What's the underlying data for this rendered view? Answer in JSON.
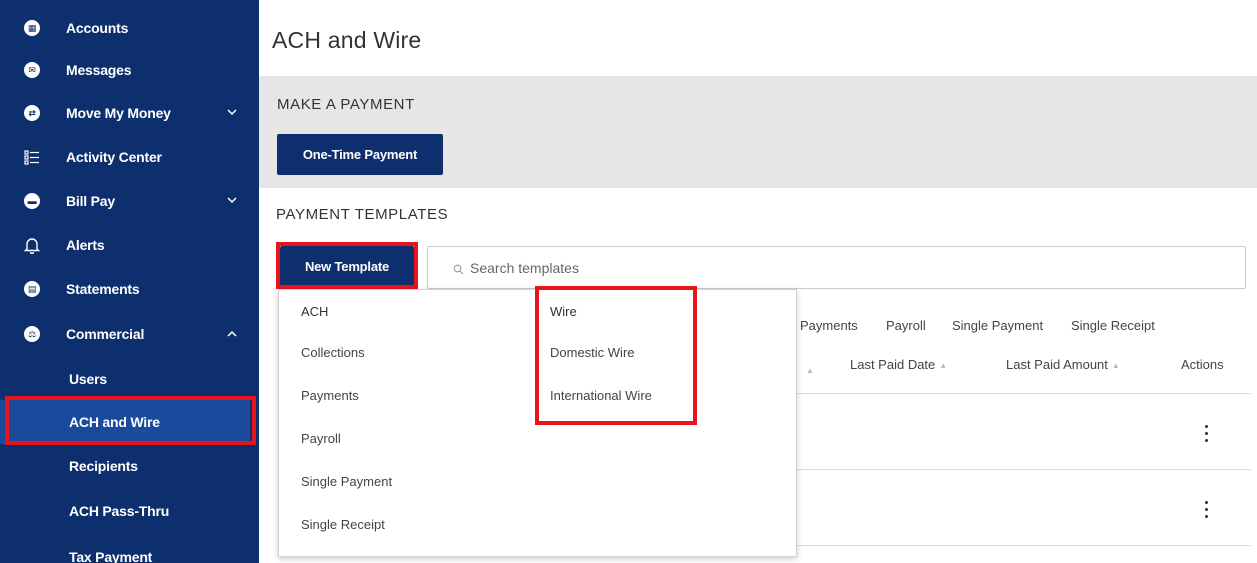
{
  "sidebar": {
    "items": [
      {
        "label": "Accounts",
        "icon": "accounts-icon"
      },
      {
        "label": "Messages",
        "icon": "messages-icon"
      },
      {
        "label": "Move My Money",
        "icon": "move-money-icon",
        "chevron": "v"
      },
      {
        "label": "Activity Center",
        "icon": "activity-center-icon"
      },
      {
        "label": "Bill Pay",
        "icon": "bill-pay-icon",
        "chevron": "v"
      },
      {
        "label": "Alerts",
        "icon": "bell-icon"
      },
      {
        "label": "Statements",
        "icon": "statements-icon"
      },
      {
        "label": "Commercial",
        "icon": "commercial-icon",
        "chevron": "^"
      }
    ],
    "sub_items": [
      {
        "label": "Users"
      },
      {
        "label": "ACH and Wire",
        "active": true
      },
      {
        "label": "Recipients"
      },
      {
        "label": "ACH Pass-Thru"
      },
      {
        "label": "Tax Payment"
      }
    ]
  },
  "main": {
    "title": "ACH and Wire",
    "make_payment": {
      "title": "MAKE A PAYMENT",
      "button": "One-Time Payment"
    },
    "templates": {
      "title": "PAYMENT TEMPLATES",
      "new_button": "New Template",
      "search_placeholder": "Search templates",
      "filters": [
        "Payments",
        "Payroll",
        "Single Payment",
        "Single Receipt"
      ],
      "columns": [
        "Last Paid Date",
        "Last Paid Amount",
        "Actions"
      ]
    },
    "dropdown": {
      "ach_header": "ACH",
      "ach_items": [
        "Collections",
        "Payments",
        "Payroll",
        "Single Payment",
        "Single Receipt"
      ],
      "wire_header": "Wire",
      "wire_items": [
        "Domestic Wire",
        "International Wire"
      ]
    }
  },
  "colors": {
    "sidebar_bg": "#0e2f6d",
    "active_bg": "#1a4a9c",
    "highlight": "#e8141b",
    "section_bg": "#e6e6e6"
  }
}
